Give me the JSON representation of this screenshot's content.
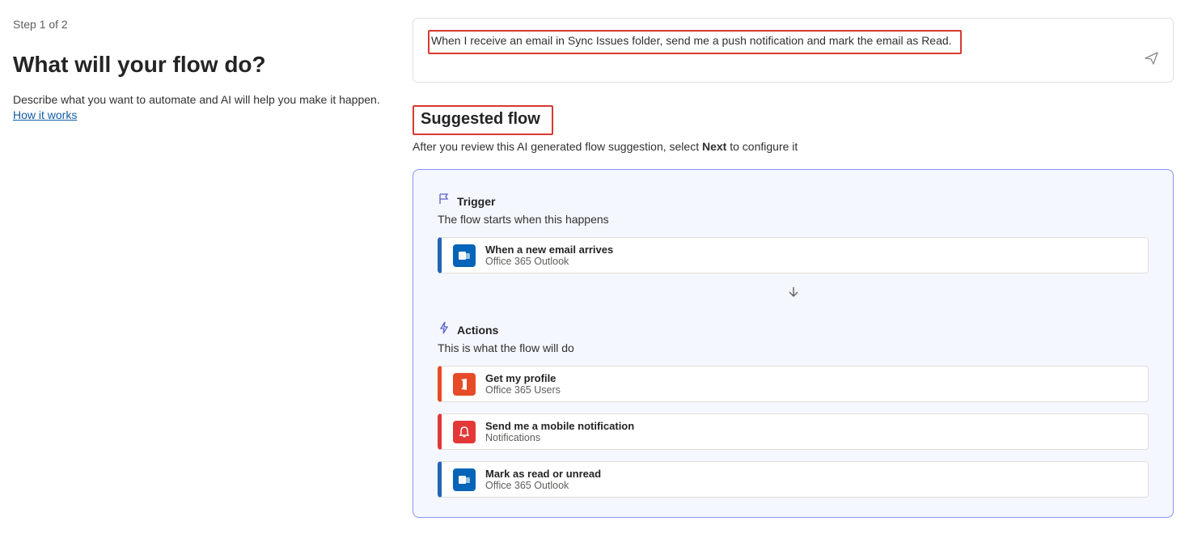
{
  "left": {
    "step": "Step 1 of 2",
    "heading": "What will your flow do?",
    "subtext": "Describe what you want to automate and AI will help you make it happen.",
    "linkText": "How it works"
  },
  "prompt": {
    "text": "When I receive an email in Sync Issues folder, send me a push notification and mark the email as Read."
  },
  "suggested": {
    "heading": "Suggested flow",
    "reviewPrefix": "After you review this AI generated flow suggestion, select ",
    "reviewBold": "Next",
    "reviewSuffix": " to configure it"
  },
  "trigger": {
    "label": "Trigger",
    "desc": "The flow starts when this happens",
    "step": {
      "title": "When a new email arrives",
      "sub": "Office 365 Outlook"
    }
  },
  "actions": {
    "label": "Actions",
    "desc": "This is what the flow will do",
    "items": [
      {
        "title": "Get my profile",
        "sub": "Office 365 Users"
      },
      {
        "title": "Send me a mobile notification",
        "sub": "Notifications"
      },
      {
        "title": "Mark as read or unread",
        "sub": "Office 365 Outlook"
      }
    ]
  }
}
